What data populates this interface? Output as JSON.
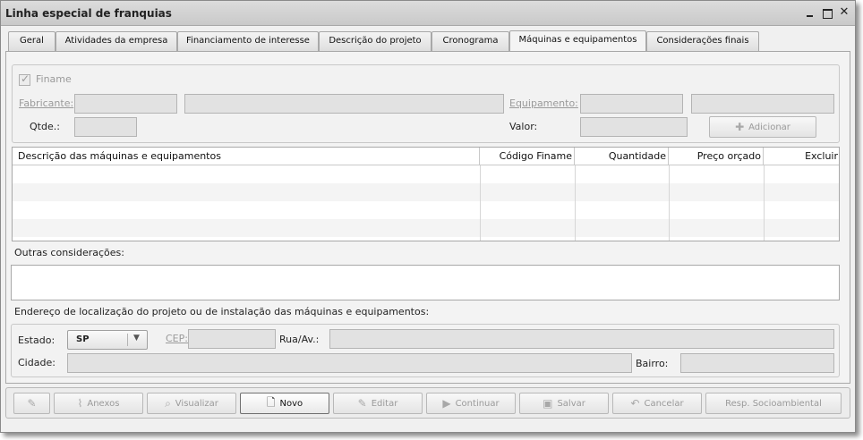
{
  "window": {
    "title": "Linha especial de franquias"
  },
  "tabs": [
    {
      "label": "Geral",
      "active": false
    },
    {
      "label": "Atividades da empresa",
      "active": false
    },
    {
      "label": "Financiamento de interesse",
      "active": false
    },
    {
      "label": "Descrição do projeto",
      "active": false
    },
    {
      "label": "Cronograma",
      "active": false
    },
    {
      "label": "Máquinas e equipamentos",
      "active": true
    },
    {
      "label": "Considerações finais",
      "active": false
    }
  ],
  "finame_form": {
    "finame_checkbox_label": "Finame",
    "finame_checked": true,
    "fabricante_label": "Fabricante:",
    "equipamento_label": "Equipamento:",
    "qtde_label": "Qtde.:",
    "valor_label": "Valor:",
    "adicionar_label": "Adicionar"
  },
  "table": {
    "columns": [
      "Descrição das máquinas e equipamentos",
      "Código Finame",
      "Quantidade",
      "Preço orçado",
      "Excluir"
    ],
    "rows": []
  },
  "outras": {
    "label": "Outras considerações:"
  },
  "endereco": {
    "label": "Endereço de localização do projeto ou de instalação das máquinas e equipamentos:",
    "estado_label": "Estado:",
    "estado_value": "SP",
    "cep_label": "CEP:",
    "rua_label": "Rua/Av.:",
    "cidade_label": "Cidade:",
    "bairro_label": "Bairro:"
  },
  "toolbar": {
    "anexos": "Anexos",
    "visualizar": "Visualizar",
    "novo": "Novo",
    "editar": "Editar",
    "continuar": "Continuar",
    "salvar": "Salvar",
    "cancelar": "Cancelar",
    "resp_socioambiental": "Resp. Socioambiental"
  }
}
